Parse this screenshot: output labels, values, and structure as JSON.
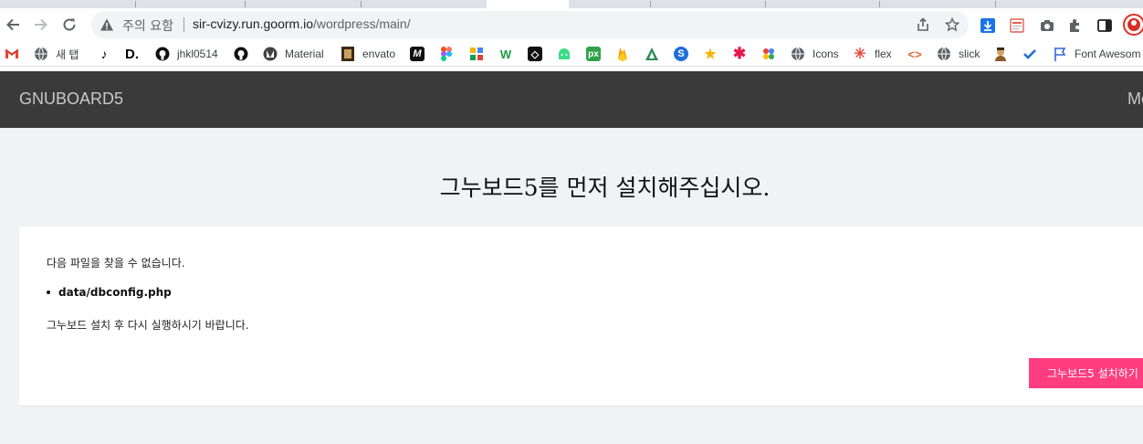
{
  "browser": {
    "omnibox": {
      "security_label": "주의 요함",
      "url_host": "sir-cvizy.run.goorm.io",
      "url_path": "/wordpress/main/"
    },
    "bookmarks": [
      {
        "icon": "gmail-icon",
        "label": ""
      },
      {
        "icon": "globe-icon",
        "label": "새 탭"
      },
      {
        "icon": "tiktok-icon",
        "label": ""
      },
      {
        "icon": "d-icon",
        "label": "D."
      },
      {
        "icon": "github-icon",
        "label": "jhkl0514"
      },
      {
        "icon": "github-icon",
        "label": ""
      },
      {
        "icon": "material-icon",
        "label": "Material"
      },
      {
        "icon": "envato-icon",
        "label": "envato"
      },
      {
        "icon": "m-icon",
        "label": ""
      },
      {
        "icon": "figma-icon",
        "label": ""
      },
      {
        "icon": "pinwheel-icon",
        "label": ""
      },
      {
        "icon": "w-icon",
        "label": ""
      },
      {
        "icon": "codepen-icon",
        "label": ""
      },
      {
        "icon": "android-icon",
        "label": ""
      },
      {
        "icon": "px-icon",
        "label": ""
      },
      {
        "icon": "firebase-icon",
        "label": ""
      },
      {
        "icon": "triangle-icon",
        "label": ""
      },
      {
        "icon": "s-icon",
        "label": ""
      },
      {
        "icon": "star-icon",
        "label": ""
      },
      {
        "icon": "asterisk-icon",
        "label": ""
      },
      {
        "icon": "dots-icon",
        "label": ""
      },
      {
        "icon": "globe-icon",
        "label": "Icons"
      },
      {
        "icon": "asterisk-icon",
        "label": "flex"
      },
      {
        "icon": "code-icon",
        "label": ""
      },
      {
        "icon": "globe-icon",
        "label": "slick"
      },
      {
        "icon": "avatar-icon",
        "label": ""
      },
      {
        "icon": "check-icon",
        "label": ""
      },
      {
        "icon": "flag-icon",
        "label": "Font Awesom"
      }
    ]
  },
  "site": {
    "logo": "GNUBOARD5",
    "menu_fragment": "Mo"
  },
  "main": {
    "title": "그누보드5를 먼저 설치해주십시오.",
    "message_intro": "다음 파일을 찾을 수 없습니다.",
    "missing_file": "data/dbconfig.php",
    "message_outro": "그누보드 설치 후 다시 실행하시기 바랍니다.",
    "install_button": "그누보드5 설치하기"
  },
  "colors": {
    "header_bg": "#3a3a3a",
    "page_bg": "#f0f2f5",
    "accent_button": "#ff3d7f"
  }
}
